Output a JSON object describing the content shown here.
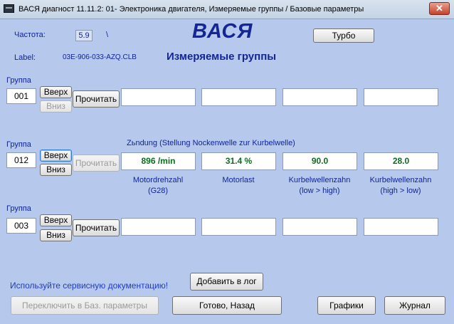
{
  "window": {
    "title": "ВАСЯ диагност 11.11.2: 01- Электроника двигателя,  Измеряемые группы / Базовые параметры",
    "close_glyph": "✕"
  },
  "header": {
    "freq_label": "Частота:",
    "freq_value": "5.9",
    "freq_suffix": "\\",
    "label_caption": "Label:",
    "label_value": "03E-906-033-AZQ.CLB",
    "logo": "ВАСЯ",
    "subtitle": "Измеряемые группы",
    "turbo_button": "Турбо"
  },
  "groups": [
    {
      "caption": "Группа",
      "number": "001",
      "up_label": "Вверх",
      "down_label": "Вниз",
      "read_label": "Прочитать",
      "description": "",
      "values": [
        "",
        "",
        "",
        ""
      ],
      "units": [
        "",
        "",
        "",
        ""
      ]
    },
    {
      "caption": "Группа",
      "number": "012",
      "up_label": "Вверх",
      "down_label": "Вниз",
      "read_label": "Прочитать",
      "description": "Zьndung (Stellung Nockenwelle zur Kurbelwelle)",
      "values": [
        "896 /min",
        "31.4 %",
        "90.0",
        "28.0"
      ],
      "units": [
        "Motordrehzahl\n(G28)",
        "Motorlast",
        "Kurbelwellenzahn\n(low > high)",
        "Kurbelwellenzahn\n(high > low)"
      ]
    },
    {
      "caption": "Группа",
      "number": "003",
      "up_label": "Вверх",
      "down_label": "Вниз",
      "read_label": "Прочитать",
      "description": "",
      "values": [
        "",
        "",
        "",
        ""
      ],
      "units": [
        "",
        "",
        "",
        ""
      ]
    }
  ],
  "footer": {
    "hint": "Используйте сервисную документацию!",
    "add_log": "Добавить в лог",
    "switch_basic": "Переключить в Баз. параметры",
    "done_back": "Готово, Назад",
    "graphs": "Графики",
    "journal": "Журнал"
  }
}
